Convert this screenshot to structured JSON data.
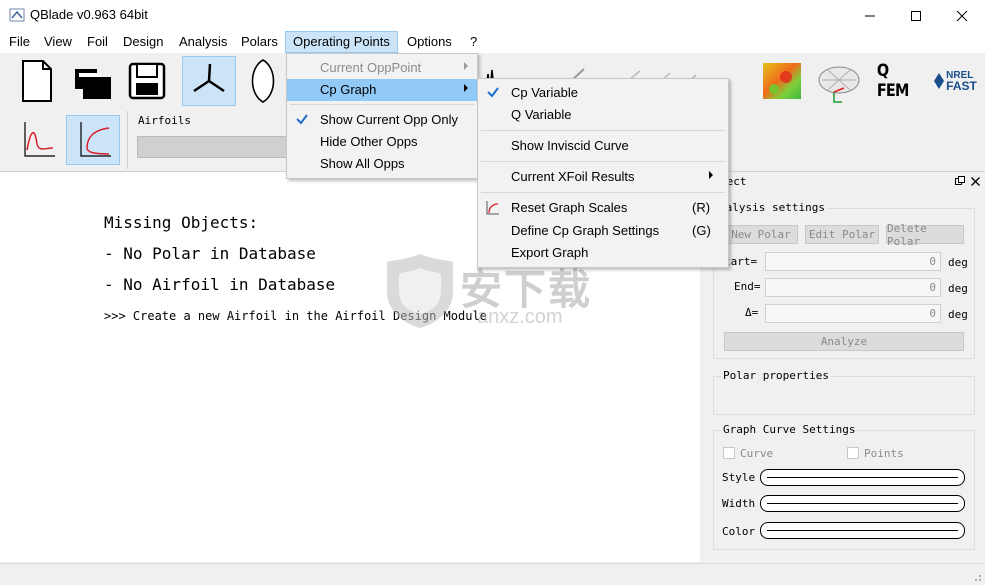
{
  "window": {
    "title": "QBlade v0.963 64bit"
  },
  "menubar": [
    "File",
    "View",
    "Foil",
    "Design",
    "Analysis",
    "Polars",
    "Operating Points",
    "Options",
    "?"
  ],
  "subbar": {
    "airfoils_label": "Airfoils"
  },
  "main": {
    "lines": [
      "Missing Objects:",
      "- No Polar in Database",
      "- No Airfoil in Database",
      ">>> Create a new Airfoil in the Airfoil Design Module"
    ]
  },
  "operating_menu": {
    "items": [
      {
        "label": "Current OppPoint",
        "disabled": true,
        "submenu": true
      },
      {
        "label": "Cp Graph",
        "highlighted": true,
        "submenu": true
      },
      {
        "label": "Show Current Opp Only",
        "checked": true
      },
      {
        "label": "Hide Other Opps"
      },
      {
        "label": "Show All Opps"
      }
    ]
  },
  "cp_menu": {
    "items": [
      {
        "label": "Cp Variable",
        "checked": true
      },
      {
        "label": "Q Variable"
      },
      {
        "label": "Show Inviscid Curve"
      },
      {
        "label": "Current XFoil Results",
        "submenu": true
      },
      {
        "label": "Reset Graph Scales",
        "shortcut": "(R)"
      },
      {
        "label": "Define Cp Graph Settings",
        "shortcut": "(G)"
      },
      {
        "label": "Export Graph"
      }
    ]
  },
  "dock": {
    "title_fragment": "rect",
    "analysis_settings": "nalysis settings",
    "buttons": [
      "New Polar",
      "Edit Polar",
      "Delete Polar"
    ],
    "fields": [
      {
        "label": "tart=",
        "value": "0",
        "unit": "deg"
      },
      {
        "label": "End=",
        "value": "0",
        "unit": "deg"
      },
      {
        "label": "Δ=",
        "value": "0",
        "unit": "deg"
      }
    ],
    "analyze_label": "Analyze",
    "polar_properties": "Polar properties",
    "graph_curve_settings": "Graph Curve Settings",
    "curve_label": "Curve",
    "points_label": "Points",
    "style_label": "Style",
    "width_label": "Width",
    "color_label": "Color"
  },
  "toolbar": {
    "qfem_label": "Q FEM",
    "nrel_label": "NREL",
    "fast_label": "FAST"
  },
  "watermark": {
    "cn": "安下载",
    "domain": "anxz.com"
  },
  "colors": {
    "highlight": "#91c9f7",
    "menu_active": "#cce4f7",
    "check": "#1e6fd0"
  }
}
